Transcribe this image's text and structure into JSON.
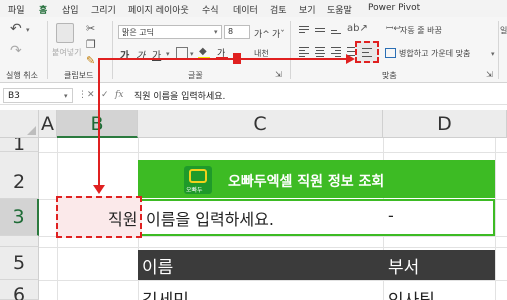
{
  "menu": {
    "items": [
      "파일",
      "홈",
      "삽입",
      "그리기",
      "페이지 레이아웃",
      "수식",
      "데이터",
      "검토",
      "보기",
      "도움말",
      "Power Pivot"
    ],
    "active": "홈"
  },
  "ribbon": {
    "undo_label": "실행 취소",
    "clipboard_label": "클립보드",
    "paste_label": "붙여넣기",
    "font_label": "글꼴",
    "font_name": "맑은 고딕",
    "font_size": "8",
    "grow_font": "가^",
    "shrink_font": "가ˇ",
    "bold": "가",
    "italic": "가",
    "underline": "가",
    "font_color_letter": "가",
    "phonetic": "내천",
    "alignment_label": "맞춤",
    "wrap_text": "자동 줄 바꿈",
    "merge_center": "병합하고 가운데 맞춤",
    "number_format": "일",
    "accent_color": "#1e6b36",
    "highlight_color": "#e02020"
  },
  "formula_bar": {
    "name_box": "B3",
    "fx": "fx",
    "content": "직원 이름을 입력하세요."
  },
  "sheet": {
    "columns": [
      "A",
      "B",
      "C",
      "D"
    ],
    "rows": [
      "1",
      "2",
      "3",
      "5",
      "6"
    ],
    "selected_column": "B",
    "selected_row": "3",
    "logo_text": "오빠두",
    "title": "오빠두엑셀 직원 정보 조회",
    "title_color": "#3dbb24",
    "b3_text": "직원",
    "c3_text": "이름을 입력하세요.",
    "d3_text": "-",
    "header_name": "이름",
    "header_dept": "부서",
    "row6_name": "김세민",
    "row6_dept": "인사팀"
  }
}
